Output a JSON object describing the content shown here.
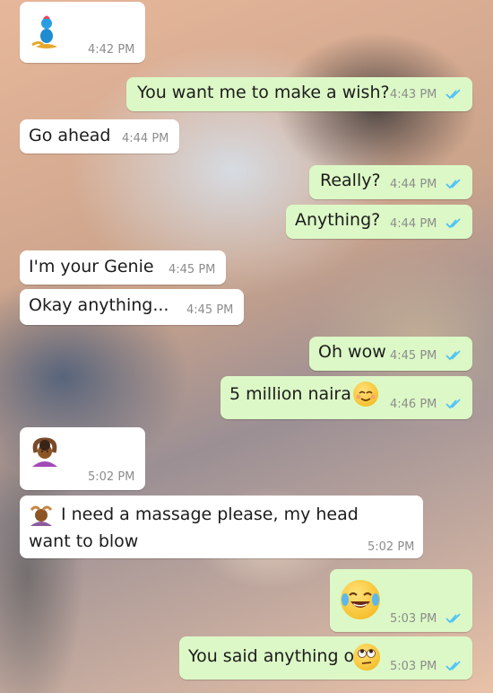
{
  "messages": [
    {
      "dir": "in",
      "text": "",
      "emoji": "genie-lamp",
      "time": "4:42 PM"
    },
    {
      "dir": "out",
      "text": "You want me to make a wish?",
      "time": "4:43 PM"
    },
    {
      "dir": "in",
      "text": "Go ahead",
      "time": "4:44 PM"
    },
    {
      "dir": "out",
      "text": "Really?",
      "time": "4:44 PM"
    },
    {
      "dir": "out",
      "text": "Anything?",
      "time": "4:44 PM"
    },
    {
      "dir": "in",
      "text": "I'm your Genie",
      "time": "4:45 PM"
    },
    {
      "dir": "in",
      "text": "Okay anything...",
      "time": "4:45 PM"
    },
    {
      "dir": "out",
      "text": "Oh wow",
      "time": "4:45 PM"
    },
    {
      "dir": "out",
      "text": "5 million naira",
      "emoji": "relieved-face",
      "time": "4:46 PM"
    },
    {
      "dir": "in",
      "text": "",
      "emoji": "woman-gesturing-ok",
      "time": "5:02 PM"
    },
    {
      "dir": "in",
      "text": "I need a massage please, my head",
      "text2": "want to blow",
      "emoji": "person-getting-massage",
      "time": "5:02 PM"
    },
    {
      "dir": "out",
      "text": "",
      "emoji": "face-with-tears-of-joy",
      "time": "5:03 PM"
    },
    {
      "dir": "out",
      "text": "You said anything o",
      "emoji": "face-with-rolling-eyes",
      "time": "5:03 PM"
    }
  ],
  "colors": {
    "incoming": "#ffffff",
    "outgoing": "#dcf8c6",
    "read_tick": "#4fc3f7",
    "time": "#8c8c8c"
  }
}
